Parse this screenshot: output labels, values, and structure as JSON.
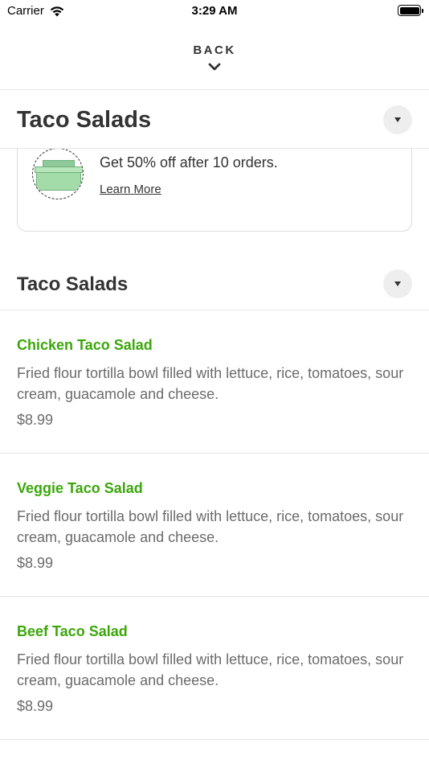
{
  "status_bar": {
    "carrier": "Carrier",
    "time": "3:29 AM"
  },
  "header": {
    "back_label": "BACK"
  },
  "section_header_sticky": {
    "title": "Taco Salads"
  },
  "promo": {
    "text": "Get 50% off after 10 orders.",
    "link": "Learn More"
  },
  "section": {
    "title": "Taco Salads"
  },
  "items": [
    {
      "name": "Chicken Taco Salad",
      "description": "Fried flour tortilla bowl filled with lettuce, rice, tomatoes, sour cream, guacamole and cheese.",
      "price": "$8.99"
    },
    {
      "name": "Veggie Taco Salad",
      "description": "Fried flour tortilla bowl filled with lettuce, rice, tomatoes, sour cream, guacamole and cheese.",
      "price": "$8.99"
    },
    {
      "name": "Beef Taco Salad",
      "description": "Fried flour tortilla bowl filled with lettuce, rice, tomatoes, sour cream, guacamole and cheese.",
      "price": "$8.99"
    }
  ],
  "colors": {
    "item_name": "#3aa70a",
    "text": "#333333",
    "muted": "#6b6b6b",
    "divider": "#e6e6e6"
  }
}
